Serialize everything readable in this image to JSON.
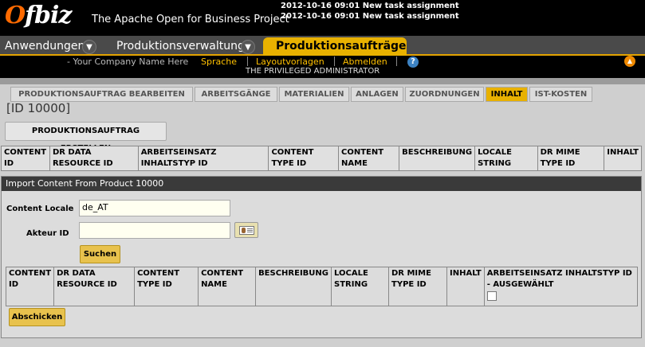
{
  "header": {
    "logo": "ofbiz",
    "tagline": "The Apache Open for Business Project",
    "notifications": [
      "2012-10-16 09:01 New task assignment",
      "2012-10-16 09:01 New task assignment"
    ]
  },
  "app_tabs": [
    {
      "label": "Anwendungen"
    },
    {
      "label": "Produktionsverwaltung"
    },
    {
      "label": "Produktionsaufträge"
    }
  ],
  "subheader": {
    "company": "- Your Company Name Here",
    "links": [
      "Sprache",
      "Layoutvorlagen",
      "Abmelden"
    ],
    "user": "THE PRIVILEGED ADMINISTRATOR",
    "help": "?",
    "up": "▲"
  },
  "content_tabs": [
    "PRODUKTIONSAUFTRAG BEARBEITEN",
    "ARBEITSGÄNGE",
    "MATERIALIEN",
    "ANLAGEN",
    "ZUORDNUNGEN",
    "INHALT",
    "IST-KOSTEN"
  ],
  "active_tab": "INHALT",
  "page_title": "[ID 10000]",
  "create_button": "PRODUKTIONSAUFTRAG ERSTELLEN",
  "content_table": {
    "columns": [
      "CONTENT ID",
      "DR DATA RESOURCE ID",
      "ARBEITSEINSATZ INHALTSTYP ID",
      "CONTENT TYPE ID",
      "CONTENT NAME",
      "BESCHREIBUNG",
      "LOCALE STRING",
      "DR MIME TYPE ID",
      "INHALT"
    ]
  },
  "import_panel": {
    "title": "Import Content From Product 10000",
    "content_locale_label": "Content Locale",
    "content_locale_value": "de_AT",
    "akteur_label": "Akteur ID",
    "akteur_value": "",
    "search_button": "Suchen",
    "columns": [
      "CONTENT ID",
      "DR DATA RESOURCE ID",
      "CONTENT TYPE ID",
      "CONTENT NAME",
      "BESCHREIBUNG",
      "LOCALE STRING",
      "DR MIME TYPE ID",
      "INHALT",
      "ARBEITSEINSATZ INHALTSTYP ID - AUSGEWÄHLT"
    ],
    "submit_button": "Abschicken"
  }
}
